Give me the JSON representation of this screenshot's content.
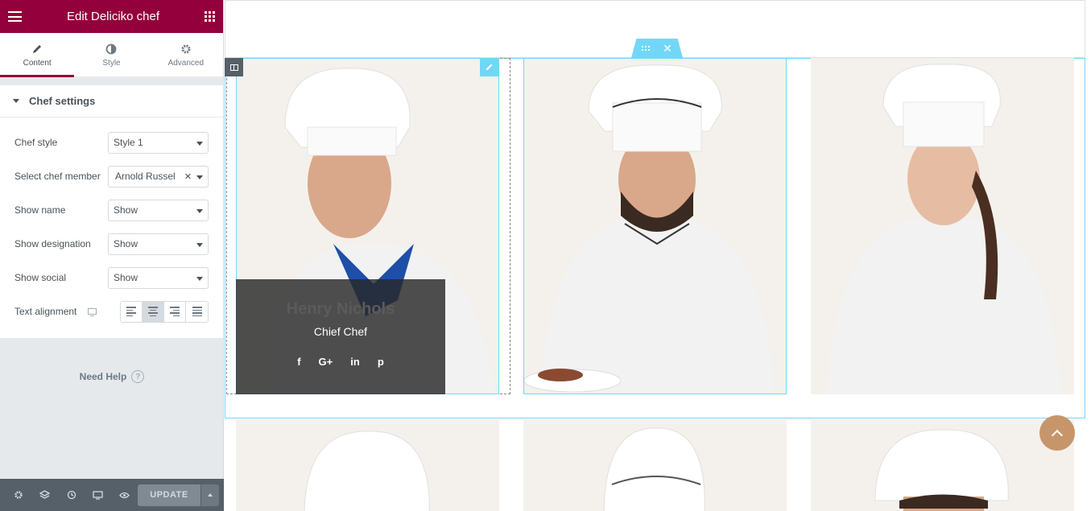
{
  "panel": {
    "title": "Edit Deliciko chef",
    "tabs": [
      {
        "label": "Content",
        "icon": "pencil-icon",
        "active": true
      },
      {
        "label": "Style",
        "icon": "half-circle-icon",
        "active": false
      },
      {
        "label": "Advanced",
        "icon": "gear-icon",
        "active": false
      }
    ],
    "section_title": "Chef settings",
    "controls": {
      "chef_style": {
        "label": "Chef style",
        "value": "Style 1"
      },
      "chef_member": {
        "label": "Select chef member",
        "value": "Arnold Russel"
      },
      "show_name": {
        "label": "Show name",
        "value": "Show"
      },
      "show_designation": {
        "label": "Show designation",
        "value": "Show"
      },
      "show_social": {
        "label": "Show social",
        "value": "Show"
      },
      "text_alignment": {
        "label": "Text alignment",
        "selected": "center"
      }
    },
    "help": "Need Help",
    "help_icon": "?",
    "footer": {
      "update_label": "UPDATE"
    }
  },
  "preview": {
    "chef": {
      "name": "Henry Nichols",
      "designation": "Chief Chef"
    },
    "socials": [
      "f",
      "G+",
      "in",
      "p"
    ]
  },
  "colors": {
    "brand": "#93003c",
    "accent": "#71d7f7",
    "back_to_top": "#c7956a"
  }
}
